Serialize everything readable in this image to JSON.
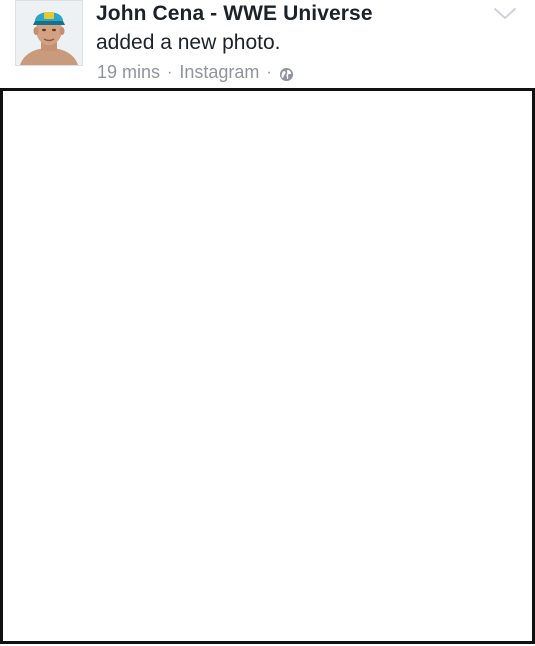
{
  "post": {
    "author_name": "John Cena - WWE Universe",
    "action_text": "added a new photo.",
    "timestamp": "19 mins",
    "separator": "·",
    "source": "Instagram",
    "privacy_icon": "globe-icon",
    "menu_icon": "chevron-down-icon"
  },
  "colors": {
    "name_text": "#1d2129",
    "meta_text": "#90949c",
    "photo_border": "#111111"
  }
}
